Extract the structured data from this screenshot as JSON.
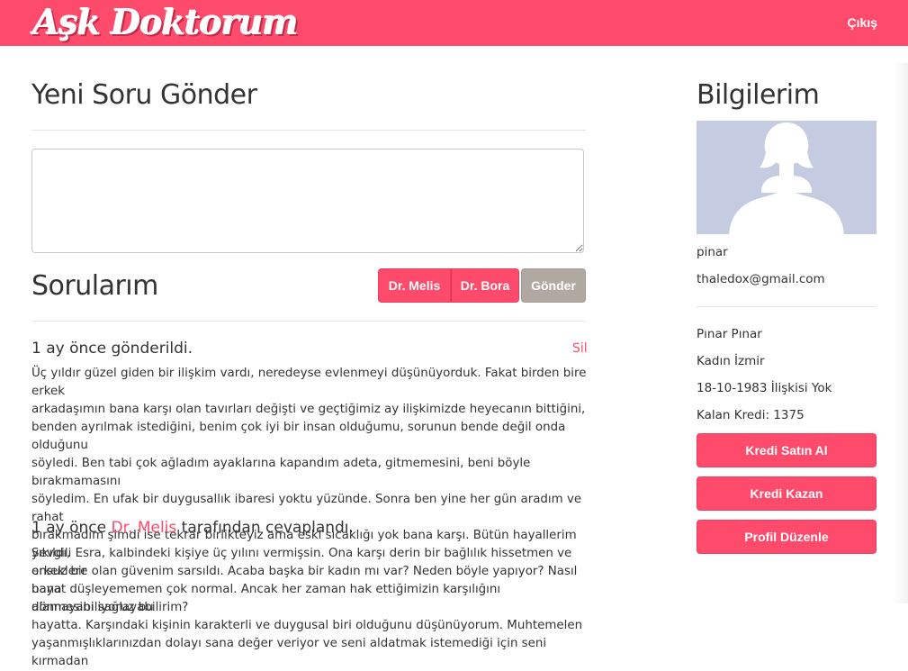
{
  "brand": {
    "logo_text": "Aşk Doktorum"
  },
  "nav": {
    "logout_label": "Çıkış"
  },
  "new_question": {
    "title": "Yeni Soru Gönder",
    "textarea_value": "",
    "placeholder": ""
  },
  "my_questions": {
    "title": "Sorularım",
    "doctor_buttons": [
      "Dr. Melis",
      "Dr. Bora"
    ],
    "send_label": "Gönder"
  },
  "question": {
    "sent_text": "1 ay önce gönderildi.",
    "delete_label": "Sil",
    "body_lines": [
      "Üç yıldır güzel giden bir ilişkim vardı, neredeyse evlenmeyi düşünüyorduk. Fakat birden bire erkek",
      "arkadaşımın bana karşı olan tavırları değişti ve geçtiğimiz ay ilişkimizde heyecanın bittiğini,",
      "benden ayrılmak istediğini, benim çok iyi bir insan olduğumu, sorunun bende değil onda olduğunu",
      "söyledi. Ben tabi çok ağladım ayaklarına kapandım adeta, gitmemesini, beni böyle bırakmamasını",
      "söyledim. En ufak bir duygusallık ibaresi yoktu yüzünde. Sonra ben yine her gün aradım ve rahat",
      "bırakmadım şimdi ise tekrar birlikteyiz ama eski sıcaklığı yok bana karşı. Bütün hayallerim yıkıldı,",
      "erkeklere olan güvenim sarsıldı. Acaba başka bir kadın mı var? Neden böyle yapıyor? Nasıl bana",
      "dönmesini sağlayabilirim?"
    ]
  },
  "answer": {
    "time_prefix": "1 ay önce",
    "doctor": "Dr. Melis",
    "suffix": "tarafından cevaplandı.",
    "body_lines": [
      "Sevgili Esra, kalbindeki kişiye üç yılını vermişsin. Ona karşı derin bir bağlılık hissetmen ve onsuz bir",
      "hayat düşleyememen çok normal. Ancak her zaman hak ettiğimizin karşılığını alamayabiliyoruz bu",
      "hayatta. Karşındaki kişinin karakterli ve duygusal biri olduğunu düşünüyorum. Muhtemelen",
      "yaşanmışlıklarınızdan dolayı sana değer veriyor ve seni aldatmak istemediği için seni kırmadan"
    ]
  },
  "sidebar": {
    "title": "Bilgilerim",
    "username": "pinar",
    "email": "thaledox@gmail.com",
    "full_name": "Pınar Pınar",
    "gender_city": "Kadın İzmir",
    "birth_status": "18-10-1983 İlişkisi Yok",
    "credit_text": "Kalan Kredi: 1375",
    "buttons": [
      "Kredi Satın Al",
      "Kredi Kazan",
      "Profil Düzenle"
    ]
  },
  "colors": {
    "brand": "#fe4a6b",
    "send_button": "#b0a9a2",
    "avatar_bg": "#c5cbe0"
  },
  "icons": {
    "avatar": "female-silhouette-icon"
  }
}
